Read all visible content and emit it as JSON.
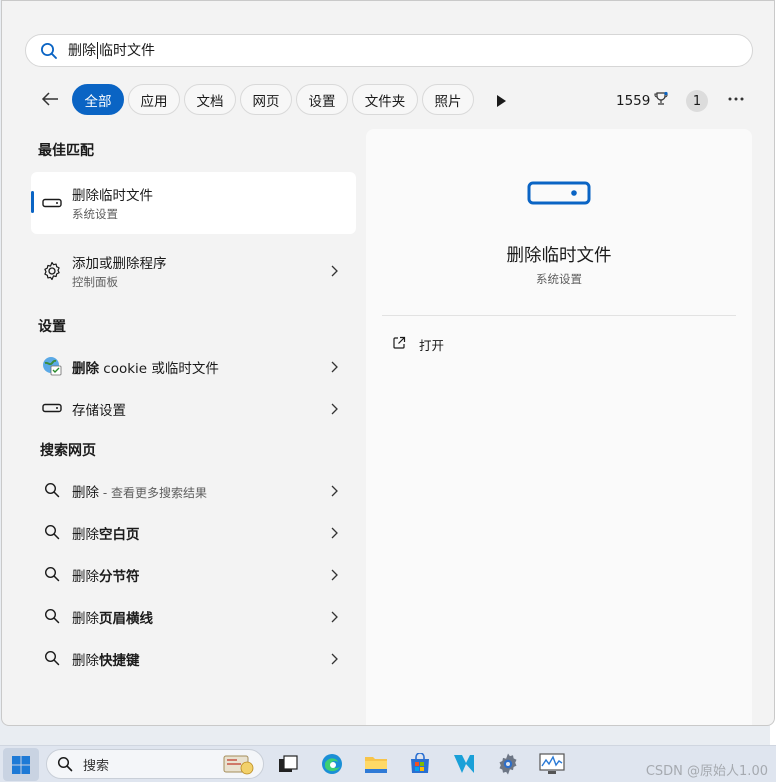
{
  "search": {
    "query_prefix": "删除",
    "query_suffix": "临时文件"
  },
  "filters": {
    "chips": [
      {
        "label": "全部",
        "active": true
      },
      {
        "label": "应用"
      },
      {
        "label": "文档"
      },
      {
        "label": "网页"
      },
      {
        "label": "设置"
      },
      {
        "label": "文件夹"
      },
      {
        "label": "照片"
      }
    ],
    "points": "1559",
    "badge_count": "1"
  },
  "left": {
    "best_match_title": "最佳匹配",
    "best_match": {
      "title": "删除临时文件",
      "subtitle": "系统设置",
      "icon": "storage-drive-icon"
    },
    "add_remove": {
      "title": "添加或删除程序",
      "subtitle": "控制面板",
      "icon": "gear-icon"
    },
    "settings_title": "设置",
    "settings_items": [
      {
        "title_bold": "删除",
        "title_rest": " cookie 或临时文件",
        "icon": "internet-options-icon"
      },
      {
        "title": "存储设置",
        "icon": "storage-drive-icon"
      }
    ],
    "web_title": "搜索网页",
    "web_items": [
      {
        "bold": "删除",
        "hint": " - 查看更多搜索结果"
      },
      {
        "bold": "删除",
        "rest": "空白页"
      },
      {
        "bold": "删除",
        "rest": "分节符"
      },
      {
        "bold": "删除",
        "rest": "页眉横线"
      },
      {
        "bold": "删除",
        "rest": "快捷键"
      }
    ]
  },
  "detail": {
    "title": "删除临时文件",
    "subtitle": "系统设置",
    "open_label": "打开"
  },
  "taskbar": {
    "search_label": "搜索",
    "watermark": "CSDN @原始人1.00"
  },
  "colors": {
    "accent": "#0a64c4",
    "window_bg": "#f3f3f3",
    "detail_bg": "#fafafa"
  }
}
